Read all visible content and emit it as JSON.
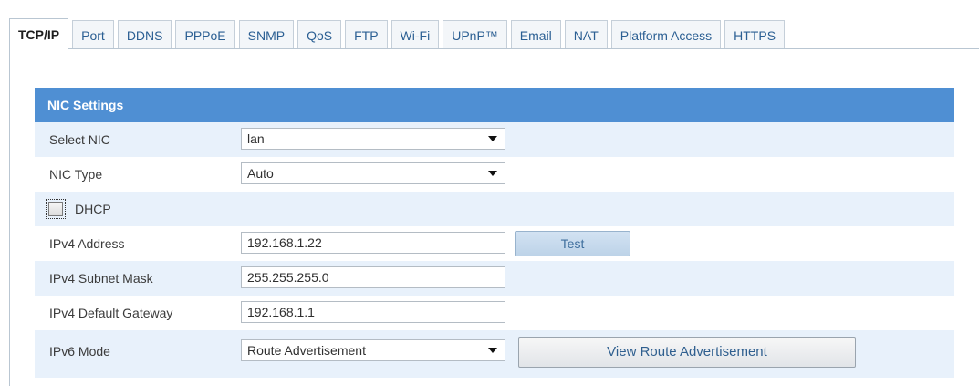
{
  "tabs": [
    {
      "label": "TCP/IP",
      "active": true
    },
    {
      "label": "Port"
    },
    {
      "label": "DDNS"
    },
    {
      "label": "PPPoE"
    },
    {
      "label": "SNMP"
    },
    {
      "label": "QoS"
    },
    {
      "label": "FTP"
    },
    {
      "label": "Wi-Fi"
    },
    {
      "label": "UPnP™"
    },
    {
      "label": "Email"
    },
    {
      "label": "NAT"
    },
    {
      "label": "Platform Access"
    },
    {
      "label": "HTTPS"
    }
  ],
  "section": {
    "title": "NIC Settings"
  },
  "form": {
    "select_nic": {
      "label": "Select NIC",
      "value": "lan"
    },
    "nic_type": {
      "label": "NIC Type",
      "value": "Auto"
    },
    "dhcp": {
      "label": "DHCP",
      "checked": false
    },
    "ipv4_address": {
      "label": "IPv4 Address",
      "value": "192.168.1.22"
    },
    "test_button": "Test",
    "ipv4_subnet_mask": {
      "label": "IPv4 Subnet Mask",
      "value": "255.255.255.0"
    },
    "ipv4_default_gateway": {
      "label": "IPv4 Default Gateway",
      "value": "192.168.1.1"
    },
    "ipv6_mode": {
      "label": "IPv6 Mode",
      "value": "Route Advertisement"
    },
    "view_route_button": "View Route Advertisement"
  },
  "colors": {
    "header_bg": "#4f8fd3",
    "row_shade": "#e8f1fb",
    "tab_text": "#2b5f93"
  },
  "icons": {
    "dropdown": "caret-down-icon",
    "checkbox": "checkbox-icon"
  }
}
